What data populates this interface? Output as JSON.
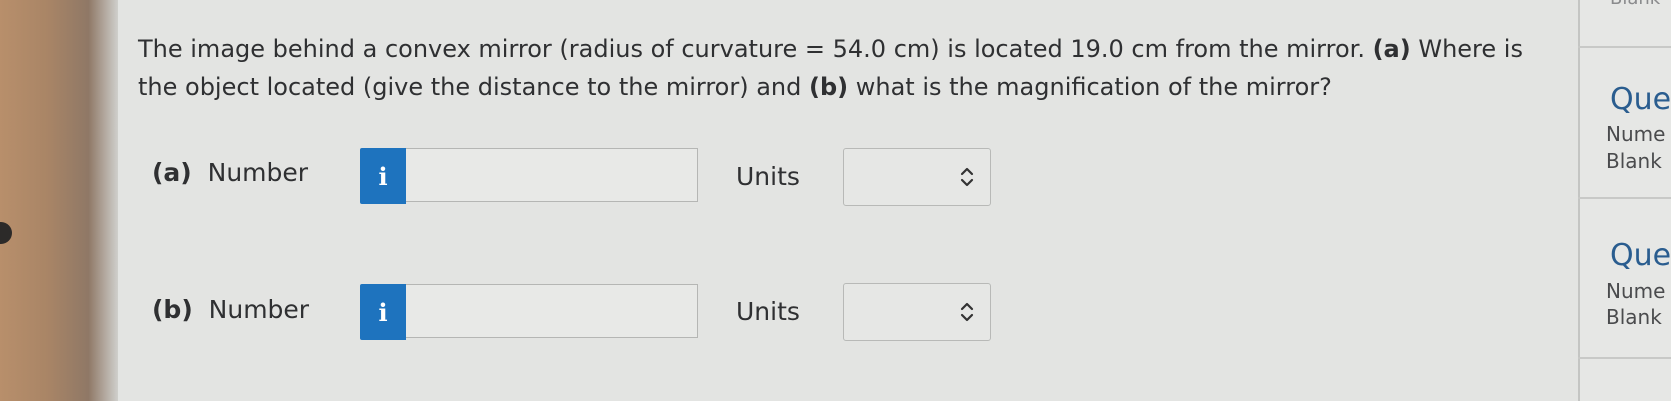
{
  "question": {
    "text_1": "The image behind a convex mirror (radius of curvature = 54.0 cm) is located 19.0 cm from the mirror. ",
    "part_a_marker": "(a)",
    "text_2": " Where is the object located (give the distance to the mirror) and ",
    "part_b_marker": "(b)",
    "text_3": " what is the magnification of the mirror?"
  },
  "rows": [
    {
      "part": "(a)",
      "number_label": "Number",
      "info_icon": "i",
      "number_value": "",
      "units_label": "Units",
      "units_value": ""
    },
    {
      "part": "(b)",
      "number_label": "Number",
      "info_icon": "i",
      "number_value": "",
      "units_label": "Units",
      "units_value": ""
    }
  ],
  "sidebar": {
    "top_cut": "Blank",
    "sections": [
      {
        "title": "Ques",
        "line1": "Nume",
        "line2": "Blank"
      },
      {
        "title": "Ques",
        "line1": "Nume",
        "line2": "Blank"
      }
    ]
  },
  "colors": {
    "info_button": "#1e73be",
    "sidebar_title": "#2a5d8f"
  }
}
